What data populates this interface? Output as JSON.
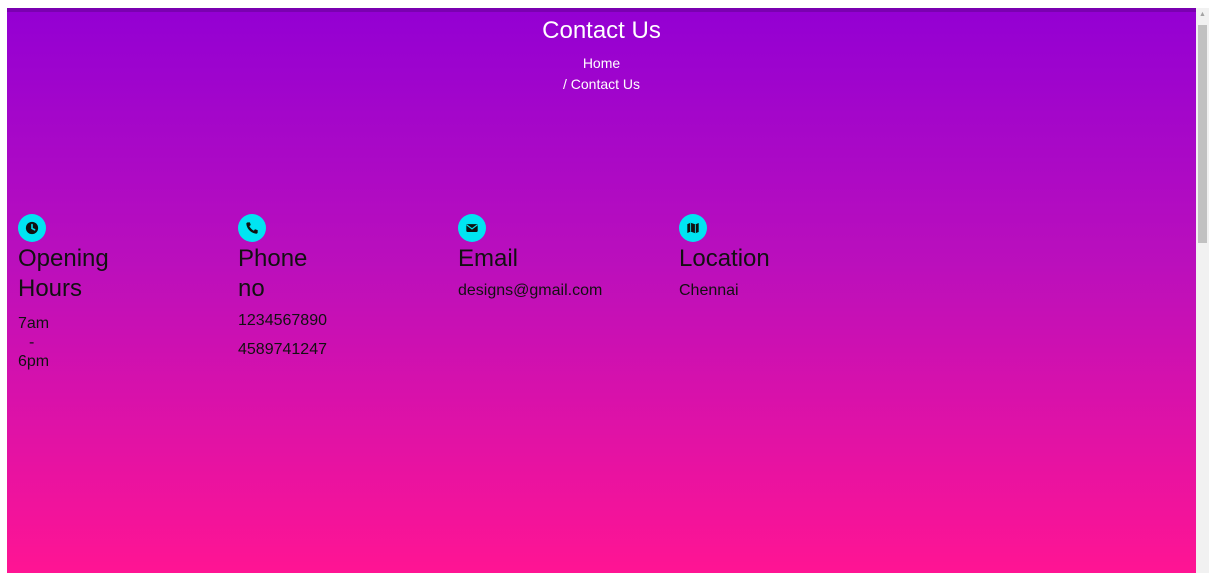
{
  "header": {
    "title": "Contact Us",
    "breadcrumb_home": "Home",
    "breadcrumb_current": "/ Contact Us"
  },
  "cards": [
    {
      "icon": "clock-icon",
      "title_line1": "Opening",
      "title_line2": "Hours",
      "lines": [
        "7am",
        "-",
        "6pm"
      ]
    },
    {
      "icon": "phone-icon",
      "title_line1": "Phone",
      "title_line2": "no",
      "lines": [
        "1234567890",
        "4589741247"
      ]
    },
    {
      "icon": "envelope-icon",
      "title_line1": "Email",
      "lines": [
        "designs@gmail.com"
      ]
    },
    {
      "icon": "map-icon",
      "title_line1": "Location",
      "lines": [
        "Chennai"
      ]
    }
  ],
  "colors": {
    "gradient_top": "#9400d3",
    "gradient_bottom": "#ff1493",
    "icon_bg": "#00e5f2"
  }
}
